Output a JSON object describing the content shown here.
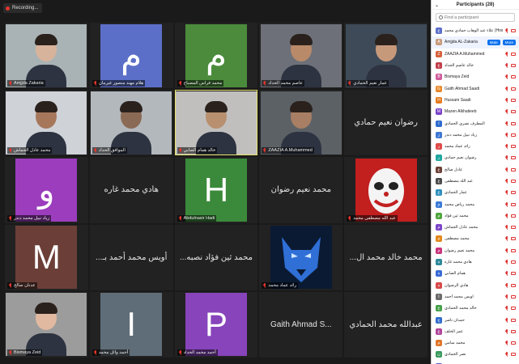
{
  "recording": {
    "label": "Recording..."
  },
  "tiles": [
    {
      "name": "Amjjda Zakaria",
      "kind": "video",
      "bg": "#a9b3b5",
      "skin": "#d8b39c"
    },
    {
      "name": "هلام مهند منصور غيرمان",
      "kind": "letter",
      "letter": "م",
      "color": "#5c6fc8"
    },
    {
      "name": "محمد فراس المصباح",
      "kind": "letter",
      "letter": "م",
      "color": "#4b8b3b"
    },
    {
      "name": "عاصم محمد الحداد",
      "kind": "video",
      "bg": "#6d7078",
      "skin": "#b98a6a"
    },
    {
      "name": "عمار نعيم الحمادي",
      "kind": "video",
      "bg": "#3e4a57",
      "skin": "#c7997b"
    },
    {
      "name": "محمد عادل الجماش",
      "kind": "video",
      "bg": "#cfd3d8",
      "skin": "#a7775c"
    },
    {
      "name": "الموافق الحداد",
      "kind": "video",
      "bg": "#b3b8bd",
      "skin": "#8b6a55"
    },
    {
      "name": "خالد همام الصابي",
      "kind": "video",
      "bg": "#c0bfbd",
      "skin": "#b8906f",
      "active": true
    },
    {
      "name": "ZAAZIA A.Muhammed",
      "kind": "video",
      "bg": "#5c6166",
      "skin": "#a87f64"
    },
    {
      "name": "رضوان نعيم حمادي",
      "kind": "text"
    },
    {
      "name": "زياد نبيل محمد دندر",
      "kind": "letter",
      "letter": "و",
      "color": "#9b3dbd"
    },
    {
      "name": "هادي محمد غاره",
      "kind": "text"
    },
    {
      "name": "Abdulnasir Hadi",
      "kind": "letter",
      "letter": "H",
      "color": "#3b8a3b"
    },
    {
      "name": "محمد نعيم رضوان",
      "kind": "text"
    },
    {
      "name": "عبد الله مصطفى محمد",
      "kind": "clown"
    },
    {
      "name": "عدنان صالح",
      "kind": "letter",
      "letter": "M",
      "color": "#6b3f37"
    },
    {
      "name": "...أويس محمد أحمد بـ",
      "kind": "text"
    },
    {
      "name": "...محمد ثين فؤاد نصبه",
      "kind": "text"
    },
    {
      "name": "رائد عماد محمد",
      "kind": "wolf"
    },
    {
      "name": "...محمد خالد محمد ال",
      "kind": "text"
    },
    {
      "name": "Bismaya Zeid",
      "kind": "video",
      "bg": "#9c9c9c",
      "skin": "#e0b9a0"
    },
    {
      "name": "أحمد وائل محمد",
      "kind": "letter",
      "letter": "I",
      "color": "#5f6d78"
    },
    {
      "name": "أحمد محمد الحداد",
      "kind": "letter",
      "letter": "P",
      "color": "#8844bb"
    },
    {
      "name": "Gaith Ahmad S...",
      "kind": "text"
    },
    {
      "name": "عبدالله محمد الحمادي",
      "kind": "text"
    }
  ],
  "panel": {
    "title": "Participants (28)",
    "search_placeholder": "Find a participant",
    "mute_label": "Mute",
    "more_label": "More",
    "participants": [
      {
        "name": "علاء عبد الوهاب حمادي محمد (Host, me)",
        "color": "#5c6fc8",
        "letter": "ع"
      },
      {
        "name": "Amjjda AL-Zakaria",
        "color": "#c79b7c",
        "letter": "A",
        "highlight": true
      },
      {
        "name": "ZAAZIA A.Muhammed",
        "color": "#d7613a",
        "letter": "Z"
      },
      {
        "name": "خالد عاصم الحداد",
        "color": "#c23e4a",
        "letter": "خ"
      },
      {
        "name": "Bismaya Zeid",
        "color": "#d05b9a",
        "letter": "B"
      },
      {
        "name": "Gaith Ahmad Saadi",
        "color": "#e88a2a",
        "letter": "G"
      },
      {
        "name": "Hussam Saadi",
        "color": "#e57b1f",
        "letter": "H"
      },
      {
        "name": "Mazen Alkhatieeb",
        "color": "#7a42c9",
        "letter": "M"
      },
      {
        "name": "المطرف نصري الحمادي",
        "color": "#2f6ccd",
        "letter": "ا"
      },
      {
        "name": "زياد نبيل محمد دندر",
        "color": "#3f78d3",
        "letter": "ز"
      },
      {
        "name": "رائد عماد محمد",
        "color": "#e04a4a",
        "letter": "ر"
      },
      {
        "name": "رضوان نعيم حمادي",
        "color": "#1fa7a0",
        "letter": "ر"
      },
      {
        "name": "عادل صالح",
        "color": "#6b3f37",
        "letter": "ع"
      },
      {
        "name": "عبد الله مصطفى",
        "color": "#4a4a4a",
        "letter": "ع"
      },
      {
        "name": "عمار الحمادي",
        "color": "#2e8fbd",
        "letter": "ع"
      },
      {
        "name": "محمد رياض محمد",
        "color": "#3a7ad6",
        "letter": "م"
      },
      {
        "name": "محمد ثين فؤاد",
        "color": "#50a63f",
        "letter": "م"
      },
      {
        "name": "محمد عادل الجماش",
        "color": "#7d45c8",
        "letter": "م"
      },
      {
        "name": "محمد مصطفى",
        "color": "#e3881d",
        "letter": "م"
      },
      {
        "name": "محمد نعيم رضوان",
        "color": "#c9357a",
        "letter": "م"
      },
      {
        "name": "هادي محمد غاره",
        "color": "#2e8a9a",
        "letter": "ه"
      },
      {
        "name": "همام الصابي",
        "color": "#3a6bd6",
        "letter": "ه"
      },
      {
        "name": "هادي الرضوان",
        "color": "#d74a4a",
        "letter": "ه"
      },
      {
        "name": "اويس محمد أحمد",
        "color": "#6c6c6c",
        "letter": "ا"
      },
      {
        "name": "خالد محمد الحمادي",
        "color": "#45a04a",
        "letter": "خ"
      },
      {
        "name": "حمدان ناصر",
        "color": "#2f6ccd",
        "letter": "ح"
      },
      {
        "name": "عمر الخلف",
        "color": "#b0459a",
        "letter": "ع"
      },
      {
        "name": "محمد سامي",
        "color": "#e0762a",
        "letter": "م"
      },
      {
        "name": "نصر الحمادي",
        "color": "#3a9a5f",
        "letter": "ن"
      },
      {
        "name": "يوسف أحمد",
        "color": "#5a5fd0",
        "letter": "ي"
      }
    ]
  }
}
